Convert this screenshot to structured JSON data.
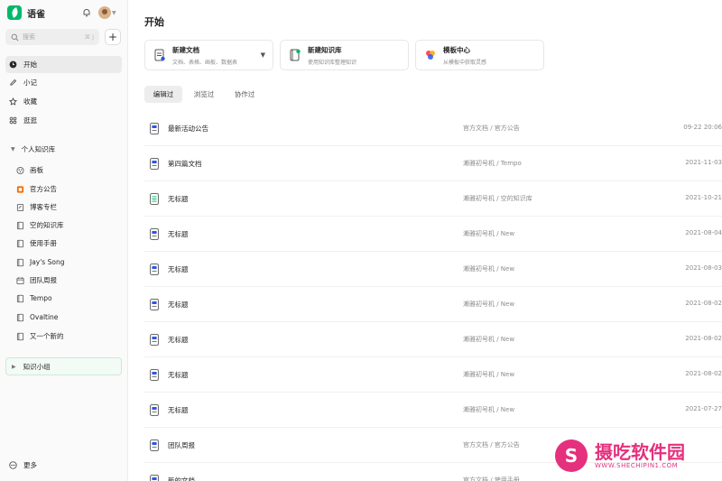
{
  "app": {
    "name": "语雀"
  },
  "search": {
    "placeholder": "搜索",
    "shortcut": "⌘ J"
  },
  "nav": [
    {
      "label": "开始",
      "icon": "clock-icon",
      "active": true
    },
    {
      "label": "小记",
      "icon": "pen-icon"
    },
    {
      "label": "收藏",
      "icon": "star-icon"
    },
    {
      "label": "逛逛",
      "icon": "grid-icon"
    }
  ],
  "knowledge": {
    "section_label": "个人知识库",
    "items": [
      {
        "label": "画板",
        "icon": "whiteboard-icon"
      },
      {
        "label": "官方公告",
        "icon": "announcement-icon"
      },
      {
        "label": "博客专栏",
        "icon": "blog-icon"
      },
      {
        "label": "空的知识库",
        "icon": "book-icon"
      },
      {
        "label": "使用手册",
        "icon": "book-icon"
      },
      {
        "label": "Jay's Song",
        "icon": "book-icon"
      },
      {
        "label": "团队周报",
        "icon": "calendar-icon"
      },
      {
        "label": "Tempo",
        "icon": "book-icon"
      },
      {
        "label": "Ovaltine",
        "icon": "book-icon"
      },
      {
        "label": "又一个新的",
        "icon": "book-icon"
      }
    ]
  },
  "group": {
    "label": "知识小组"
  },
  "more": {
    "label": "更多"
  },
  "main": {
    "title": "开始",
    "cards": [
      {
        "title": "新建文档",
        "desc": "文档、表格、画板、数据表",
        "icon": "new-doc-icon"
      },
      {
        "title": "新建知识库",
        "desc": "使用知识库整理知识",
        "icon": "new-library-icon"
      },
      {
        "title": "模板中心",
        "desc": "从模板中获取灵感",
        "icon": "template-icon"
      }
    ],
    "tabs": [
      {
        "label": "编辑过",
        "active": true
      },
      {
        "label": "浏览过"
      },
      {
        "label": "协作过"
      }
    ],
    "rows": [
      {
        "title": "最新活动公告",
        "path": "官方文档 / 官方公告",
        "date": "09-22 20:06",
        "icon": "doc-icon"
      },
      {
        "title": "第四篇文档",
        "path": "濑雅初号机 / Tempo",
        "date": "2021-11-03",
        "icon": "doc-icon"
      },
      {
        "title": "无标题",
        "path": "濑雅初号机 / 空的知识库",
        "date": "2021-10-21",
        "icon": "sheet-icon"
      },
      {
        "title": "无标题",
        "path": "濑雅初号机 / New",
        "date": "2021-08-04",
        "icon": "doc-icon"
      },
      {
        "title": "无标题",
        "path": "濑雅初号机 / New",
        "date": "2021-08-03",
        "icon": "doc-icon"
      },
      {
        "title": "无标题",
        "path": "濑雅初号机 / New",
        "date": "2021-08-02",
        "icon": "doc-icon"
      },
      {
        "title": "无标题",
        "path": "濑雅初号机 / New",
        "date": "2021-08-02",
        "icon": "doc-icon"
      },
      {
        "title": "无标题",
        "path": "濑雅初号机 / New",
        "date": "2021-08-02",
        "icon": "doc-icon"
      },
      {
        "title": "无标题",
        "path": "濑雅初号机 / New",
        "date": "2021-07-27",
        "icon": "doc-icon"
      },
      {
        "title": "团队周报",
        "path": "官方文档 / 官方公告",
        "date": "",
        "icon": "doc-icon"
      },
      {
        "title": "新的文档",
        "path": "官方文档 / 使用手册",
        "date": "",
        "icon": "doc-icon"
      }
    ]
  },
  "watermark": {
    "name": "摄吃软件园",
    "url": "WWW.SHECHIPIN1.COM"
  },
  "colors": {
    "brand": "#00b96b",
    "doc_icon": "#2f54eb",
    "sheet_icon": "#00b96b",
    "watermark": "#e5307d"
  }
}
